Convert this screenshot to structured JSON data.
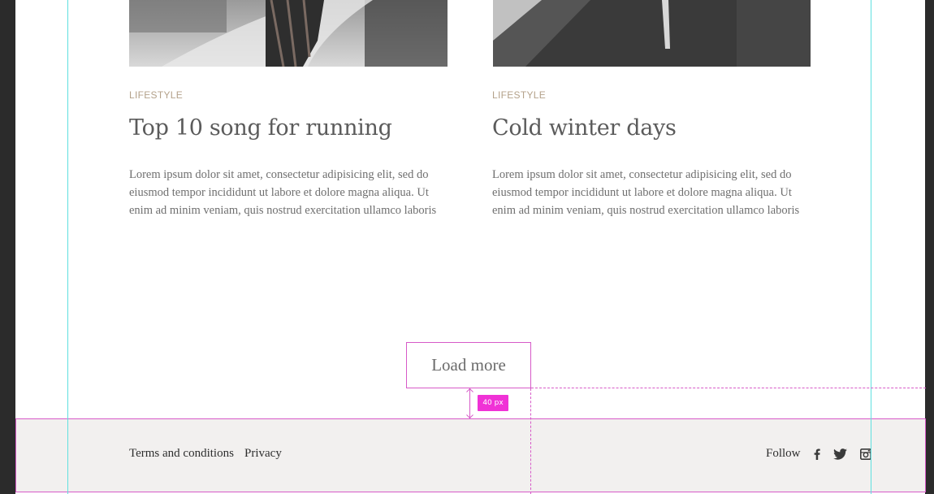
{
  "posts": [
    {
      "category": "LIFESTYLE",
      "title": "Top 10 song for running",
      "excerpt": "Lorem ipsum dolor sit amet, consectetur adipisicing elit, sed do eiusmod tempor incididunt ut labore et dolore magna aliqua. Ut enim ad minim veniam, quis nostrud exercitation ullamco laboris"
    },
    {
      "category": "LIFESTYLE",
      "title": "Cold winter days",
      "excerpt": "Lorem ipsum dolor sit amet, consectetur adipisicing elit, sed do eiusmod tempor incididunt ut labore et dolore magna aliqua. Ut enim ad minim veniam, quis nostrud exercitation ullamco laboris"
    }
  ],
  "load_more": {
    "label": "Load more"
  },
  "spacing_annotation": {
    "label": "40 px"
  },
  "footer": {
    "links": [
      "Terms and conditions",
      "Privacy"
    ],
    "follow_label": "Follow",
    "social_icons": [
      "facebook-icon",
      "twitter-icon",
      "instagram-icon"
    ]
  },
  "colors": {
    "accent_guide": "#d75ac8",
    "badge": "#f032d6",
    "grid_guide": "#5fe0e0",
    "category": "#b4a28b",
    "footer_bg": "#f2f0ef"
  }
}
